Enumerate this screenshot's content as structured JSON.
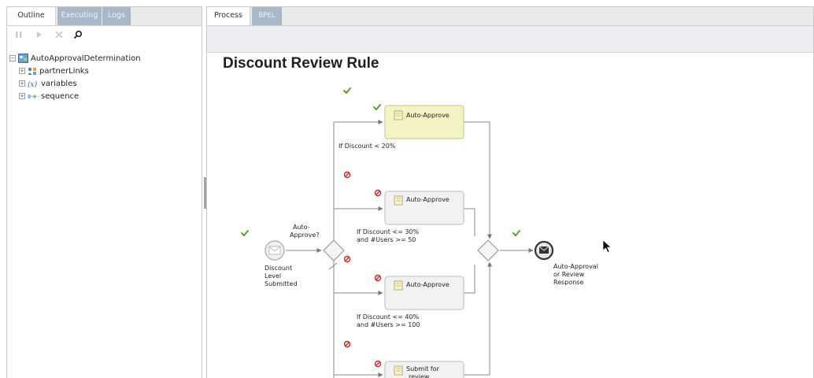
{
  "left_panel": {
    "tabs": [
      {
        "label": "Outline",
        "active": true
      },
      {
        "label": "Executing",
        "active": false
      },
      {
        "label": "Logs",
        "active": false
      }
    ],
    "toolbar_icons": [
      "pause-icon",
      "play-icon",
      "stop-icon",
      "search-icon"
    ],
    "tree": {
      "root": "AutoApprovalDetermination",
      "children": [
        {
          "label": "partnerLinks",
          "icon": "partner-links-icon"
        },
        {
          "label": "variables",
          "icon": "variables-icon"
        },
        {
          "label": "sequence",
          "icon": "sequence-icon"
        }
      ]
    }
  },
  "right_panel": {
    "tabs": [
      {
        "label": "Process",
        "active": true
      },
      {
        "label": "BPEL",
        "active": false
      }
    ]
  },
  "diagram": {
    "title": "Discount Review Rule",
    "start_event": {
      "line1": "Discount",
      "line2": "Level",
      "line3": "Submitted"
    },
    "gateway_label": {
      "line1": "Auto-",
      "line2": "Approve?"
    },
    "tasks": [
      {
        "label": "Auto-Approve",
        "state": "completed"
      },
      {
        "label": "Auto-Approve",
        "state": "skipped"
      },
      {
        "label": "Auto-Approve",
        "state": "skipped"
      },
      {
        "label_line1": "Submit for",
        "label_line2": "review",
        "state": "skipped"
      }
    ],
    "conditions": [
      {
        "line1": "If Discount < 20%"
      },
      {
        "line1": "If Discount <= 30%",
        "line2": "and #Users >= 50"
      },
      {
        "line1": "If Discount <= 40%",
        "line2": "and #Users >= 100"
      }
    ],
    "end_event": {
      "line1": "Auto-Approval",
      "line2": "or Review",
      "line3": "Response"
    },
    "colors": {
      "completed_check": "#5aa02c",
      "skipped_mark": "#d0262b",
      "active_task_fill": "#f4f3c3",
      "task_fill": "#f2f2f2"
    }
  }
}
